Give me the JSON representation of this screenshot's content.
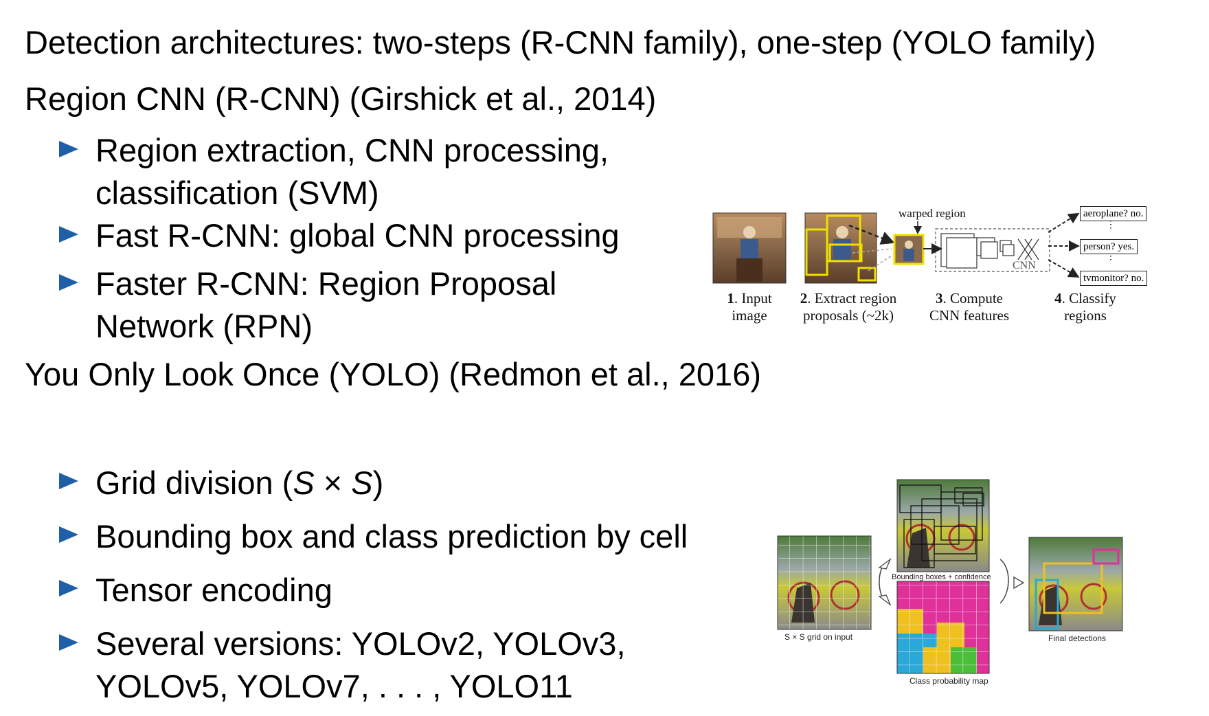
{
  "headings": {
    "top": "Detection architectures: two-steps (R-CNN family), one-step (YOLO family)",
    "rcnn": "Region CNN (R-CNN) (Girshick et al., 2014)",
    "yolo": "You Only Look Once (YOLO) (Redmon et al., 2016)"
  },
  "rcnn_bullets": [
    {
      "line1": "Region extraction, CNN processing,",
      "line2": "classification (SVM)"
    },
    {
      "line1": "Fast R-CNN: global CNN processing"
    },
    {
      "line1": "Faster R-CNN: Region Proposal",
      "line2": "Network (RPN)"
    }
  ],
  "yolo_bullets": {
    "grid": {
      "prefix": "Grid division (",
      "var1": "S",
      "times": " × ",
      "var2": "S",
      "suffix": ")"
    },
    "items": [
      "Bounding box and class prediction by cell",
      "Tensor encoding"
    ],
    "versions": {
      "line1": "Several versions: YOLOv2, YOLOv3,",
      "line2": "YOLOv5, YOLOv7, . . . , YOLO11"
    }
  },
  "rcnn_figure": {
    "warped_label": "warped region",
    "cnn_label": "CNN",
    "outputs": [
      "aeroplane? no.",
      "person? yes.",
      "tvmonitor? no."
    ],
    "steps": [
      {
        "num": "1",
        "line1": ". Input",
        "line2": "image"
      },
      {
        "num": "2",
        "line1": ". Extract region",
        "line2": "proposals (~2k)"
      },
      {
        "num": "3",
        "line1": ". Compute",
        "line2": "CNN features"
      },
      {
        "num": "4",
        "line1": ". Classify",
        "line2": "regions"
      }
    ]
  },
  "yolo_figure": {
    "grid_caption": "S × S grid on input",
    "bbox_caption": "Bounding boxes + confidence",
    "prob_caption": "Class probability map",
    "final_caption": "Final detections"
  },
  "colors": {
    "bullet": "#1f5fa8",
    "yolo_magenta": "#e0309a",
    "yolo_yellow": "#f0c020",
    "yolo_cyan": "#2aa8d8",
    "yolo_green": "#4cbf3a",
    "rcnn_box": "#f0e000"
  }
}
